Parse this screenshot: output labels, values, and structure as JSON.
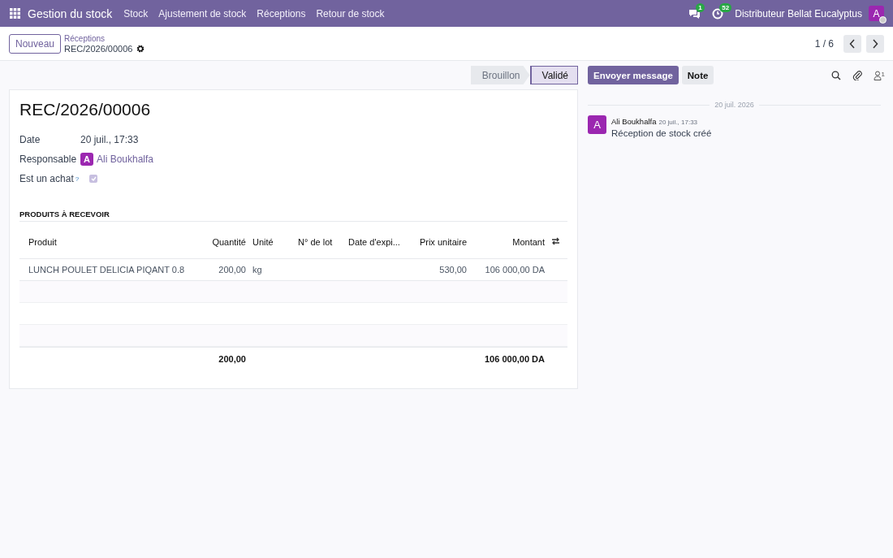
{
  "navbar": {
    "app": "Gestion du stock",
    "menu": [
      "Stock",
      "Ajustement de stock",
      "Réceptions",
      "Retour de stock"
    ],
    "messages_badge": "1",
    "activities_badge": "52",
    "company": "Distributeur Bellat Eucalyptus",
    "avatar": "A"
  },
  "control": {
    "new_button": "Nouveau",
    "breadcrumb": "Réceptions",
    "record": "REC/2026/00006",
    "pager": "1 / 6"
  },
  "statusbar": [
    {
      "label": "Brouillon",
      "selected": false
    },
    {
      "label": "Validé",
      "selected": true
    }
  ],
  "form": {
    "title": "REC/2026/00006",
    "fields": [
      {
        "kind": "text",
        "label": "Date",
        "value": "20 juil., 17:33"
      },
      {
        "kind": "user",
        "label": "Responsable",
        "avatar": "A",
        "value": "Ali Boukhalfa"
      },
      {
        "kind": "checkbox",
        "label": "Est un achat",
        "help": "?",
        "checked": true
      }
    ],
    "section": "PRODUITS À RECEVOIR",
    "table": {
      "columns": [
        "Produit",
        "Quantité",
        "Unité",
        "N° de lot",
        "Date d'expi...",
        "Prix unitaire",
        "Montant"
      ],
      "rows": [
        {
          "product": "LUNCH POULET DELICIA PIQANT 0.8",
          "quantity": "200,00",
          "unit": "kg",
          "unit_price": "530,00",
          "amount": "106 000,00 DA"
        }
      ],
      "totals": {
        "quantity": "200,00",
        "amount": "106 000,00 DA"
      }
    }
  },
  "chatter": {
    "buttons": [
      "Envoyer message",
      "Note"
    ],
    "followers": "1",
    "date_separator": "20 juil. 2026",
    "messages": [
      {
        "avatar": "A",
        "author": "Ali Boukhalfa",
        "time": "20 juil., 17:33",
        "body": "Réception de stock créé"
      }
    ]
  }
}
